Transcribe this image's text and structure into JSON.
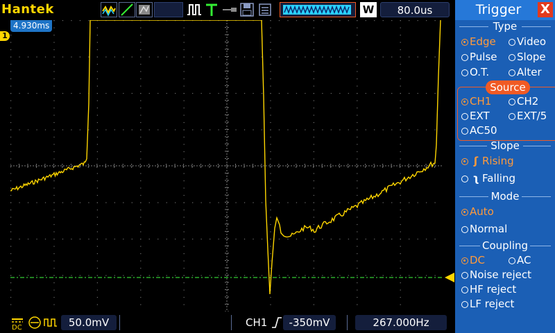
{
  "brand": "Hantek",
  "top": {
    "timebase": "80.0us",
    "w_label": "W",
    "trigger_time": "4.930ms"
  },
  "channel_marker": "1",
  "bottom": {
    "ch1_scale": "50.0mV",
    "trigger_channel": "CH1",
    "trigger_level": "-350mV",
    "frequency": "267.000Hz"
  },
  "menu": {
    "title": "Trigger",
    "close": "X",
    "type": {
      "title": "Type",
      "options": [
        "Edge",
        "Video",
        "Pulse",
        "Slope",
        "O.T.",
        "Alter"
      ],
      "selected": "Edge"
    },
    "source": {
      "title": "Source",
      "options": [
        "CH1",
        "CH2",
        "EXT",
        "EXT/5",
        "AC50"
      ],
      "selected": "CH1"
    },
    "slope": {
      "title": "Slope",
      "options": [
        "Rising",
        "Falling"
      ],
      "selected": "Rising"
    },
    "mode": {
      "title": "Mode",
      "options": [
        "Auto",
        "Normal"
      ],
      "selected": "Auto"
    },
    "coupling": {
      "title": "Coupling",
      "options": [
        "DC",
        "AC",
        "Noise reject",
        "HF reject",
        "LF reject"
      ],
      "selected": "DC"
    }
  },
  "colors": {
    "trace": "#ffd600",
    "trigger_level_line": "#33cc33",
    "menu_bg": "#1b5fb5",
    "selected": "#ff9a3c"
  }
}
